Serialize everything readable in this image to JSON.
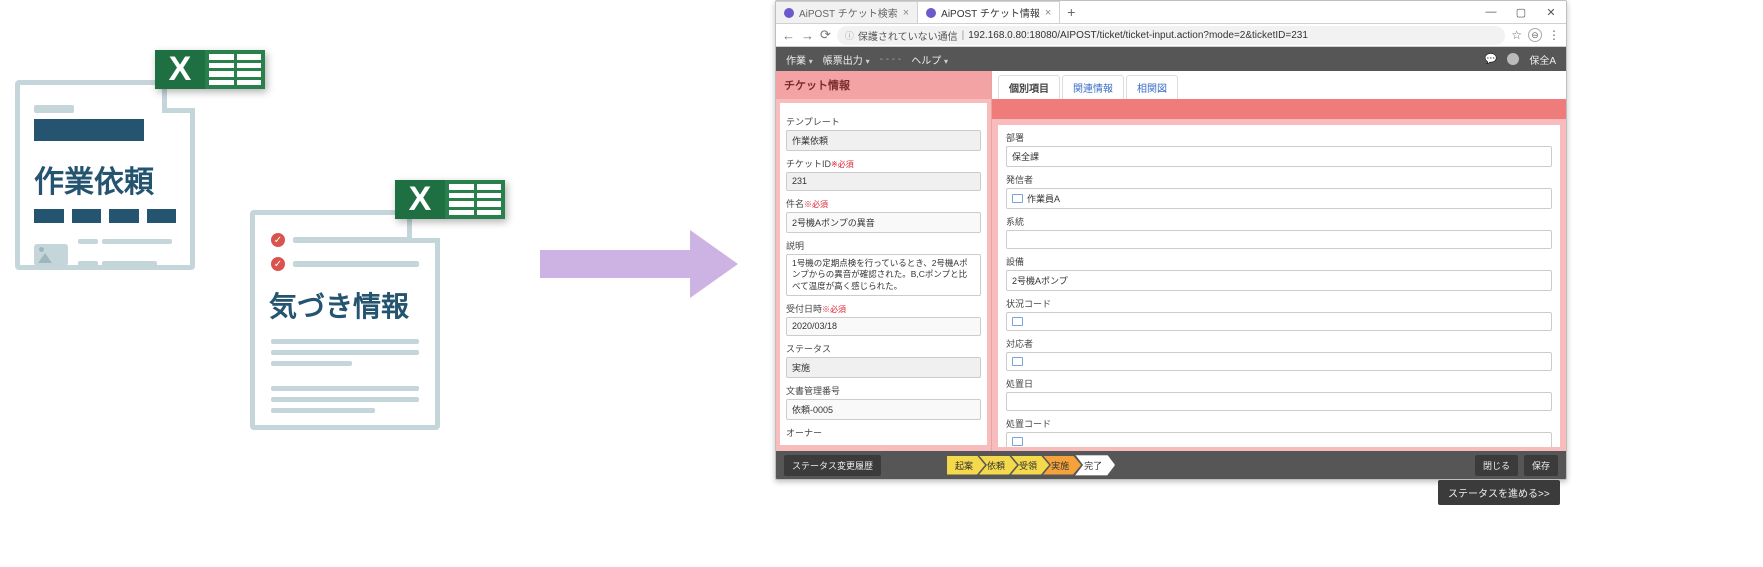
{
  "left_docs": {
    "doc1_label": "作業依頼",
    "doc2_label": "気づき情報"
  },
  "browser": {
    "tabs": {
      "inactive_title": "AiPOST チケット検索",
      "active_title": "AiPOST チケット情報"
    },
    "url": {
      "insecure_label": "保護されていない通信",
      "address": "192.168.0.80:18080/AIPOST/ticket/ticket-input.action?mode=2&ticketID=231"
    }
  },
  "appbar": {
    "menu1": "作業",
    "menu2": "帳票出力",
    "menu3": "ヘルプ",
    "user_name": "保全A"
  },
  "left_panel": {
    "header": "チケット情報",
    "fields": {
      "template_label": "テンプレート",
      "template_value": "作業依頼",
      "ticket_id_label": "チケットID",
      "required_suffix": "※必須",
      "ticket_id_value": "231",
      "subject_label": "件名",
      "subject_value": "2号機Aポンプの異音",
      "desc_label": "説明",
      "desc_value": "1号機の定期点検を行っているとき、2号機Aポンプからの異音が確認された。B,Cポンプと比べて温度が高く感じられた。",
      "received_label": "受付日時",
      "received_value": "2020/03/18",
      "status_label": "ステータス",
      "status_value": "実施",
      "docno_label": "文書管理番号",
      "docno_value": "依頼-0005",
      "owner_label": "オーナー"
    }
  },
  "right_panel": {
    "tabs": {
      "t1": "個別項目",
      "t2": "関連情報",
      "t3": "相関図"
    },
    "fields": {
      "dept_label": "部署",
      "dept_value": "保全課",
      "issuer_label": "発信者",
      "issuer_value": "作業員A",
      "system_label": "系統",
      "system_value": "",
      "equip_label": "設備",
      "equip_value": "2号機Aポンプ",
      "sitcode_label": "状況コード",
      "responder_label": "対応者",
      "resdate_label": "処置日",
      "rescode_label": "処置コード"
    }
  },
  "footer": {
    "history_btn": "ステータス変更履歴",
    "close_btn": "閉じる",
    "save_btn": "保存",
    "advance_btn": "ステータスを進める>>",
    "steps": {
      "s1": "起案",
      "s2": "依頼",
      "s3": "受領",
      "s4": "実施",
      "s5": "完了"
    }
  }
}
